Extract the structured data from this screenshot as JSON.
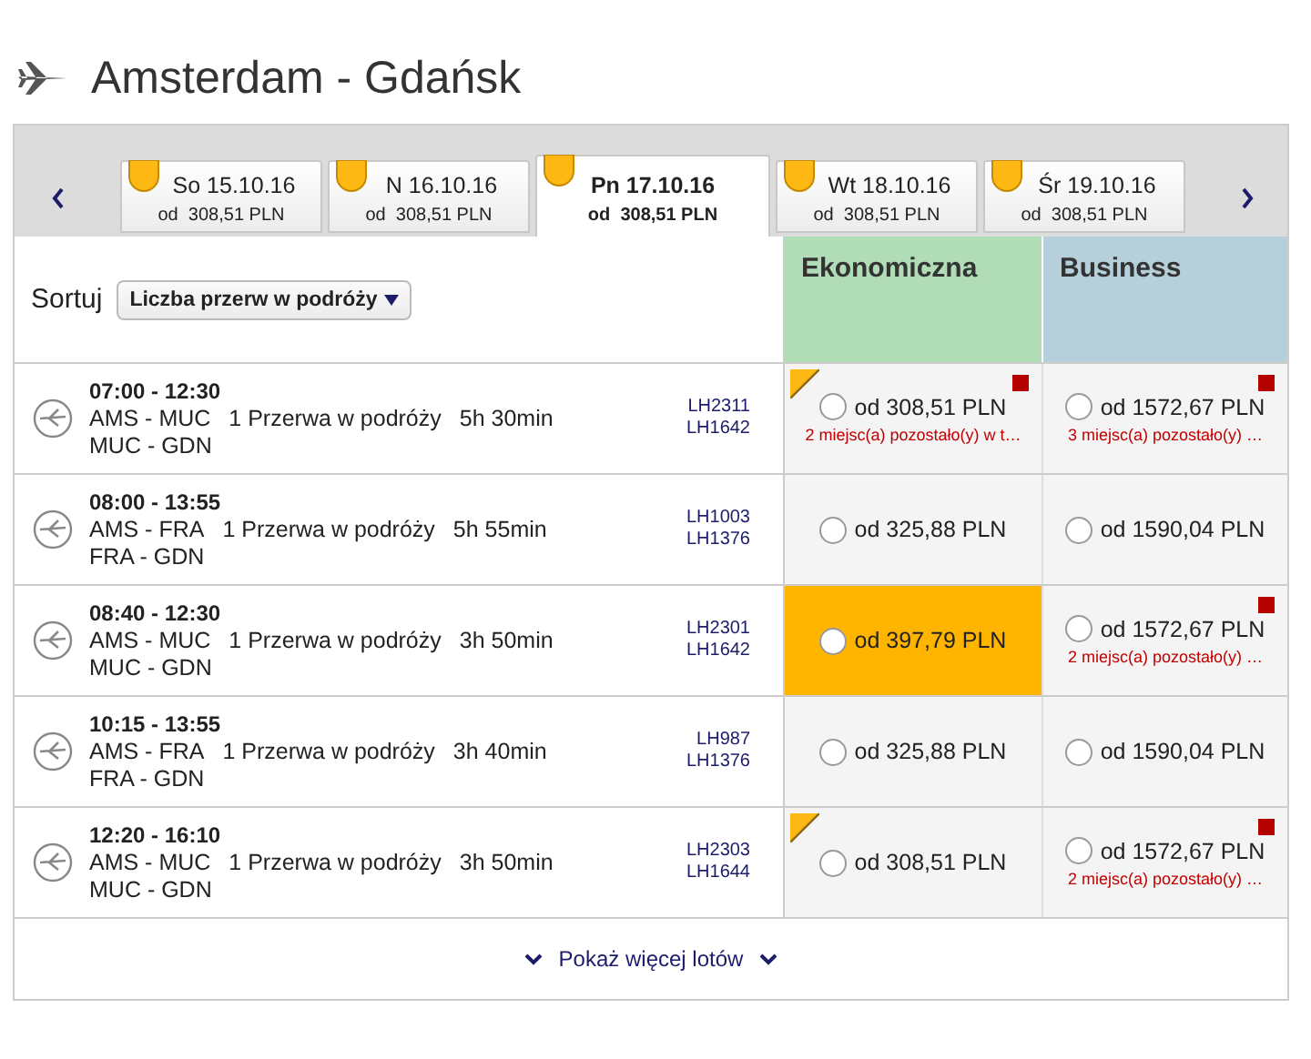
{
  "title": "Amsterdam - Gdańsk",
  "date_tabs": [
    {
      "day": "So 15.10.16",
      "price": "od  308,51 PLN",
      "selected": false
    },
    {
      "day": "N 16.10.16",
      "price": "od  308,51 PLN",
      "selected": false
    },
    {
      "day": "Pn 17.10.16",
      "price": "od  308,51 PLN",
      "selected": true
    },
    {
      "day": "Wt 18.10.16",
      "price": "od  308,51 PLN",
      "selected": false
    },
    {
      "day": "Śr 19.10.16",
      "price": "od  308,51 PLN",
      "selected": false
    }
  ],
  "sort": {
    "label": "Sortuj",
    "value": "Liczba przerw w podróży"
  },
  "cabins": [
    {
      "name": "Ekonomiczna",
      "color": "#b1ddb6"
    },
    {
      "name": "Business",
      "color": "#b6d0db"
    }
  ],
  "flights": [
    {
      "times": "07:00 - 12:30",
      "route_1": "AMS - MUC",
      "stops": "1 Przerwa w podróży",
      "duration": "5h 30min",
      "route_2": "MUC - GDN",
      "flight_numbers": [
        "LH2311",
        "LH1642"
      ],
      "fares": [
        {
          "price": "od 308,51 PLN",
          "selected": false,
          "best_price": true,
          "low_seats": true,
          "note": "2 miejsc(a) pozostało(y) w t…"
        },
        {
          "price": "od 1572,67 PLN",
          "selected": false,
          "best_price": false,
          "low_seats": true,
          "note": "3 miejsc(a) pozostało(y) …"
        }
      ]
    },
    {
      "times": "08:00 - 13:55",
      "route_1": "AMS - FRA",
      "stops": "1 Przerwa w podróży",
      "duration": "5h 55min",
      "route_2": "FRA - GDN",
      "flight_numbers": [
        "LH1003",
        "LH1376"
      ],
      "fares": [
        {
          "price": "od 325,88 PLN",
          "selected": false,
          "best_price": false,
          "low_seats": false
        },
        {
          "price": "od 1590,04 PLN",
          "selected": false,
          "best_price": false,
          "low_seats": false
        }
      ]
    },
    {
      "times": "08:40 - 12:30",
      "route_1": "AMS - MUC",
      "stops": "1 Przerwa w podróży",
      "duration": "3h 50min",
      "route_2": "MUC - GDN",
      "flight_numbers": [
        "LH2301",
        "LH1642"
      ],
      "fares": [
        {
          "price": "od 397,79 PLN",
          "selected": true,
          "best_price": false,
          "low_seats": false
        },
        {
          "price": "od 1572,67 PLN",
          "selected": false,
          "best_price": false,
          "low_seats": true,
          "note": "2 miejsc(a) pozostało(y) …"
        }
      ]
    },
    {
      "times": "10:15 - 13:55",
      "route_1": "AMS - FRA",
      "stops": "1 Przerwa w podróży",
      "duration": "3h 40min",
      "route_2": "FRA - GDN",
      "flight_numbers": [
        "LH987",
        "LH1376"
      ],
      "fares": [
        {
          "price": "od 325,88 PLN",
          "selected": false,
          "best_price": false,
          "low_seats": false
        },
        {
          "price": "od 1590,04 PLN",
          "selected": false,
          "best_price": false,
          "low_seats": false
        }
      ]
    },
    {
      "times": "12:20 - 16:10",
      "route_1": "AMS - MUC",
      "stops": "1 Przerwa w podróży",
      "duration": "3h 50min",
      "route_2": "MUC - GDN",
      "flight_numbers": [
        "LH2303",
        "LH1644"
      ],
      "fares": [
        {
          "price": "od 308,51 PLN",
          "selected": false,
          "best_price": true,
          "low_seats": false
        },
        {
          "price": "od 1572,67 PLN",
          "selected": false,
          "best_price": false,
          "low_seats": true,
          "note": "2 miejsc(a) pozostało(y) …"
        }
      ]
    }
  ],
  "more_button": "Pokaż więcej lotów"
}
